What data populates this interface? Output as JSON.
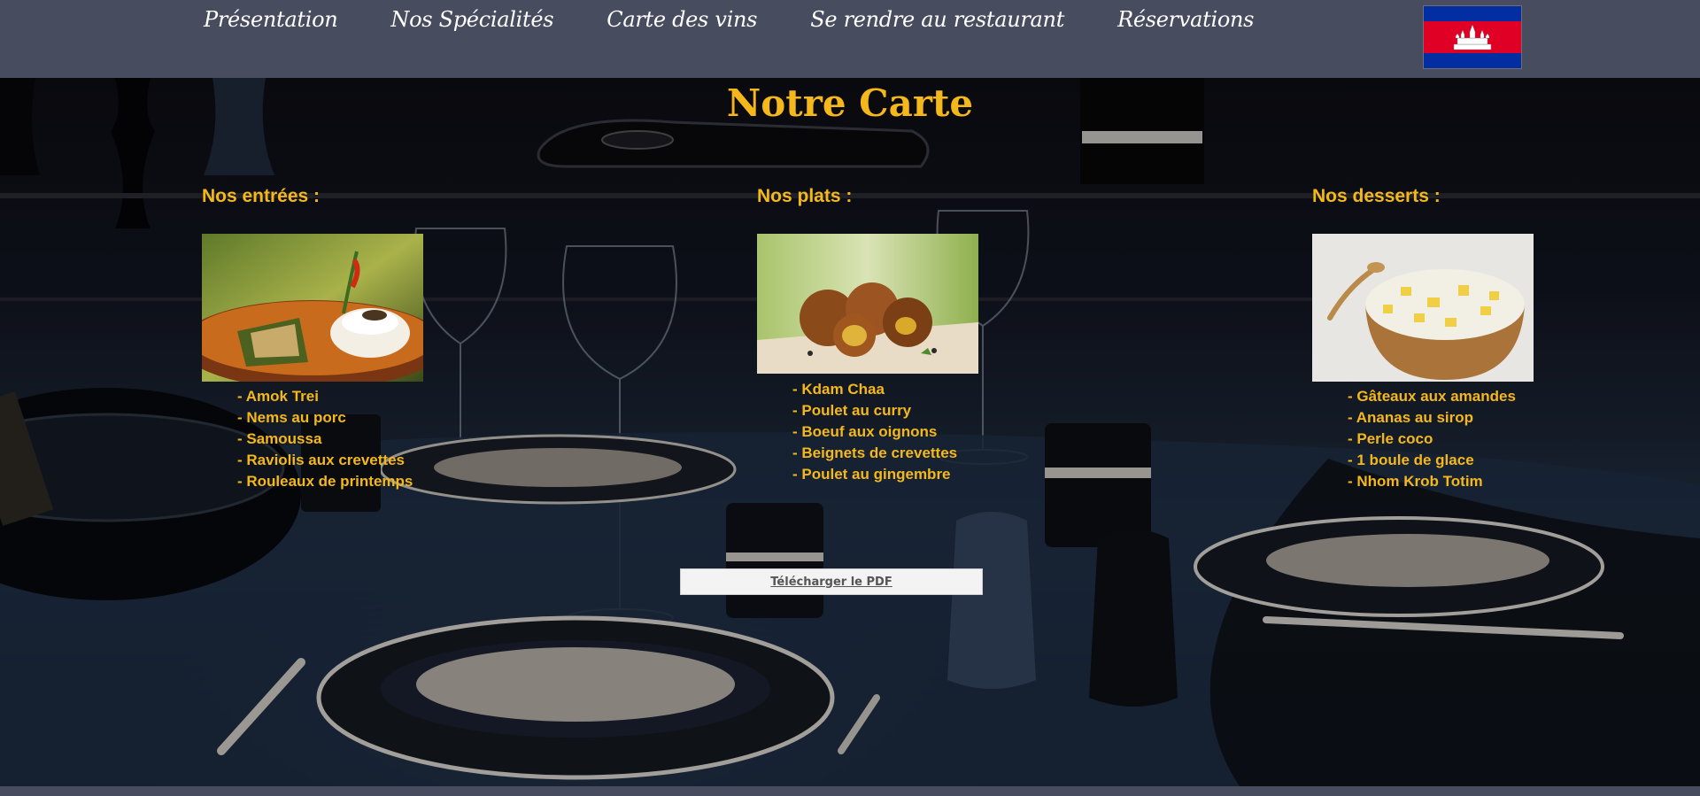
{
  "nav": {
    "items": [
      {
        "label": "Présentation"
      },
      {
        "label": "Nos Spécialités"
      },
      {
        "label": "Carte des vins"
      },
      {
        "label": "Se rendre au restaurant"
      },
      {
        "label": "Réservations"
      }
    ],
    "flag_icon": "cambodia-flag-icon"
  },
  "page": {
    "title": "Notre Carte",
    "pdf_button": "Télécharger le PDF"
  },
  "menu": {
    "starters": {
      "title": "Nos entrées :",
      "items": [
        "- Amok Trei",
        "- Nems au porc",
        "- Samoussa",
        "- Raviolis aux crevettes",
        "- Rouleaux de printemps"
      ]
    },
    "mains": {
      "title": "Nos plats :",
      "items": [
        "- Kdam Chaa",
        "- Poulet au curry",
        "- Boeuf aux oignons",
        "- Beignets de crevettes",
        "- Poulet au gingembre"
      ]
    },
    "desserts": {
      "title": "Nos desserts :",
      "items": [
        "- Gâteaux aux amandes",
        "- Ananas au sirop",
        "- Perle coco",
        "- 1 boule de glace",
        "- Nhom Krob Totim"
      ]
    }
  },
  "colors": {
    "accent": "#f5b81a",
    "nav_bg": "#474c5f",
    "flag_blue": "#032ea1",
    "flag_red": "#e00025"
  }
}
